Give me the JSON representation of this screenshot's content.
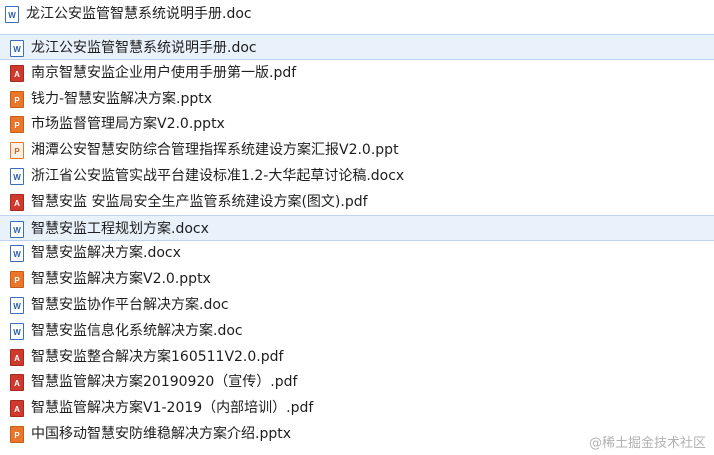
{
  "files": [
    {
      "name": "龙江公安监管智慧系统说明手册.doc",
      "type": "doc",
      "icon": "word-doc-icon",
      "selected": false
    },
    {
      "name": "龙江公安监管智慧系统说明手册.doc",
      "type": "doc",
      "icon": "word-doc-icon",
      "selected": true
    },
    {
      "name": "南京智慧安监企业用户使用手册第一版.pdf",
      "type": "pdf",
      "icon": "pdf-file-icon",
      "selected": false
    },
    {
      "name": "钱力-智慧安监解决方案.pptx",
      "type": "pptx",
      "icon": "powerpoint-file-icon",
      "selected": false
    },
    {
      "name": "市场监督管理局方案V2.0.pptx",
      "type": "pptx",
      "icon": "powerpoint-file-icon",
      "selected": false
    },
    {
      "name": "湘潭公安智慧安防综合管理指挥系统建设方案汇报V2.0.ppt",
      "type": "ppt",
      "icon": "powerpoint-file-icon",
      "selected": false
    },
    {
      "name": "浙江省公安监管实战平台建设标准1.2-大华起草讨论稿.docx",
      "type": "docx",
      "icon": "word-doc-icon",
      "selected": false
    },
    {
      "name": "智慧安监 安监局安全生产监管系统建设方案(图文).pdf",
      "type": "pdf",
      "icon": "pdf-file-icon",
      "selected": false
    },
    {
      "name": "智慧安监工程规划方案.docx",
      "type": "docx",
      "icon": "word-doc-icon",
      "selected": true
    },
    {
      "name": "智慧安监解决方案.docx",
      "type": "docx",
      "icon": "word-doc-icon",
      "selected": false
    },
    {
      "name": "智慧安监解决方案V2.0.pptx",
      "type": "pptx",
      "icon": "powerpoint-file-icon",
      "selected": false
    },
    {
      "name": "智慧安监协作平台解决方案.doc",
      "type": "doc",
      "icon": "word-doc-icon",
      "selected": false
    },
    {
      "name": "智慧安监信息化系统解决方案.doc",
      "type": "doc",
      "icon": "word-doc-icon",
      "selected": false
    },
    {
      "name": "智慧安监整合解决方案160511V2.0.pdf",
      "type": "pdf",
      "icon": "pdf-file-icon",
      "selected": false
    },
    {
      "name": "智慧监管解决方案20190920（宣传）.pdf",
      "type": "pdf",
      "icon": "pdf-file-icon",
      "selected": false
    },
    {
      "name": "智慧监管解决方案V1-2019（内部培训）.pdf",
      "type": "pdf",
      "icon": "pdf-file-icon",
      "selected": false
    },
    {
      "name": "中国移动智慧安防维稳解决方案介绍.pptx",
      "type": "pptx",
      "icon": "powerpoint-file-icon",
      "selected": false
    }
  ],
  "watermark": "@稀土掘金技术社区"
}
